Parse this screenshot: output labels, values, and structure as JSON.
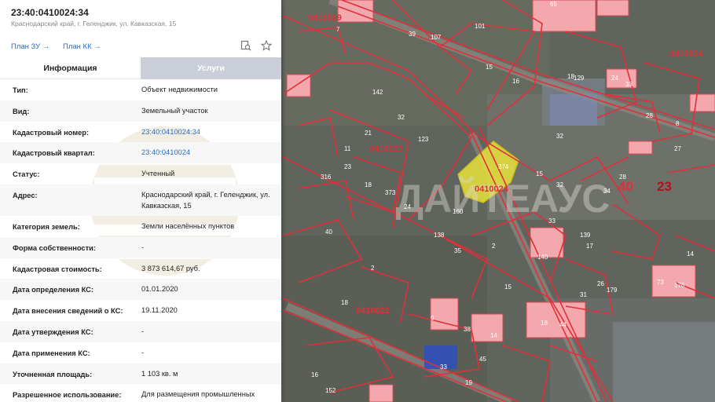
{
  "panel": {
    "cad_number": "23:40:0410024:34",
    "address_short": "Краснодарский край, г. Геленджик, ул. Кавказская, 15",
    "link_zu": "План ЗУ →",
    "link_kk": "План КК →",
    "tab_info": "Информация",
    "tab_services": "Услуги",
    "rows": [
      {
        "label": "Тип:",
        "value": "Объект недвижимости"
      },
      {
        "label": "Вид:",
        "value": "Земельный участок"
      },
      {
        "label": "Кадастровый номер:",
        "value": "23:40:0410024:34"
      },
      {
        "label": "Кадастровый квартал:",
        "value": "23:40:0410024"
      },
      {
        "label": "Статус:",
        "value": "Учтенный"
      },
      {
        "label": "Адрес:",
        "value": "Краснодарский край, г. Геленджик, ул. Кавказская, 15"
      },
      {
        "label": "Категория земель:",
        "value": "Земли населённых пунктов"
      },
      {
        "label": "Форма собственности:",
        "value": "-"
      },
      {
        "label": "Кадастровая стоимость:",
        "value": "3 873 614,67 руб."
      },
      {
        "label": "Дата определения КС:",
        "value": "01.01.2020"
      },
      {
        "label": "Дата внесения сведений о КС:",
        "value": "19.11.2020"
      },
      {
        "label": "Дата утверждения КС:",
        "value": "-"
      },
      {
        "label": "Дата применения КС:",
        "value": "-"
      },
      {
        "label": "Уточненная площадь:",
        "value": "1 103 кв. м"
      },
      {
        "label": "Разрешенное использование:",
        "value": "Для размещения промышленных"
      }
    ]
  },
  "map": {
    "watermark": "ДАЙТЕАУС",
    "quarters": [
      "0410009",
      "0410024",
      "0410023",
      "0410024",
      "0410022"
    ],
    "zone_labels": [
      "40",
      "23"
    ],
    "parcel_labels": [
      "65",
      "7",
      "39",
      "107",
      "101",
      "15",
      "16",
      "18",
      "33",
      "129",
      "142",
      "32",
      "21",
      "123",
      "11",
      "23",
      "18",
      "373",
      "24",
      "316",
      "374",
      "15",
      "32",
      "34",
      "33",
      "2",
      "160",
      "138",
      "35",
      "140",
      "139",
      "17",
      "28",
      "27",
      "32",
      "40",
      "2",
      "18",
      "9",
      "38",
      "14",
      "45",
      "33",
      "19",
      "15",
      "18",
      "44",
      "31",
      "73",
      "176",
      "179",
      "28",
      "14",
      "24",
      "8",
      "26",
      "16",
      "152",
      "21",
      "36",
      "28",
      "153",
      "56",
      "19"
    ],
    "colors": {
      "parcel_line": "#e0303a",
      "selected": "#e8e238",
      "building": "#f2a8ad"
    }
  }
}
